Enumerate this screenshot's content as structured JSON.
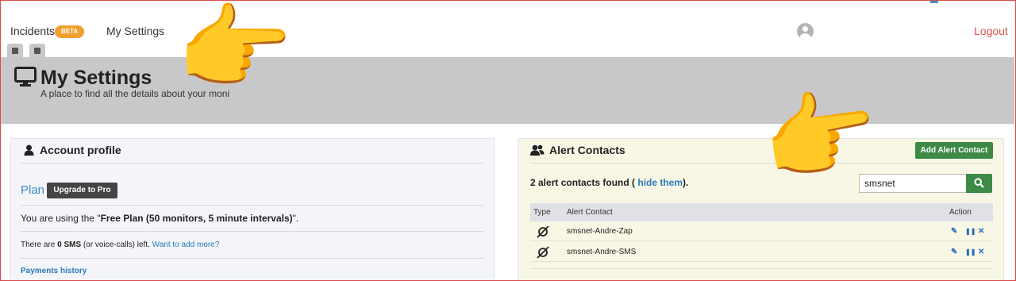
{
  "nav": {
    "incidents_label": "Incidents",
    "beta_badge": "BETA",
    "settings_label": "My Settings",
    "logout_label": "Logout"
  },
  "banner": {
    "title": "My Settings",
    "subtitle": "A place to find all the details about your moni"
  },
  "account": {
    "title": "Account profile",
    "plan_label": "Plan",
    "upgrade_label": "Upgrade to Pro",
    "plan_prefix": "You are using the \"",
    "plan_name": "Free Plan (50 monitors, 5 minute intervals)",
    "plan_suffix": "\".",
    "sms_prefix": "There are ",
    "sms_count": "0 SMS",
    "sms_middle": " (or voice-calls) left.",
    "sms_link": "Want to add more?",
    "payments_link": "Payments history"
  },
  "alerts": {
    "title": "Alert Contacts",
    "add_button": "Add Alert Contact",
    "found_prefix": "2 alert contacts found (",
    "hide_link": "hide them",
    "found_suffix": ").",
    "search_value": "smsnet",
    "columns": {
      "type": "Type",
      "contact": "Alert Contact",
      "action": "Action"
    },
    "rows": [
      {
        "name": "smsnet-Andre-Zap"
      },
      {
        "name": "smsnet-Andre-SMS"
      }
    ]
  },
  "icons": {
    "hand": "👉",
    "edit": "✎",
    "pause": "❚❚",
    "delete": "✕"
  },
  "colors": {
    "beta": "#f0a030",
    "logout": "#d9534f",
    "green_button": "#3c8a45",
    "link": "#2a7ab8"
  }
}
